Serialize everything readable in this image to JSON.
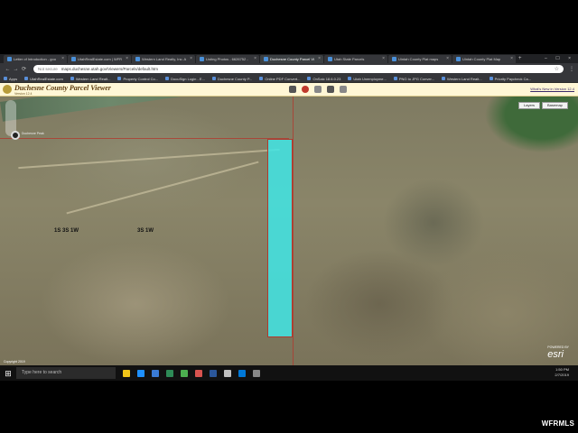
{
  "browser": {
    "tabs": [
      {
        "label": "Letter of Introduction - goo"
      },
      {
        "label": "UtahRealEstate.com | WFR"
      },
      {
        "label": "Western Land Realty, Inc. A"
      },
      {
        "label": "Listing Photos - 6626752 -"
      },
      {
        "label": "Duchesne County Parcel Vi"
      },
      {
        "label": "Utah State Parcels"
      },
      {
        "label": "Uintah County Plat maps"
      },
      {
        "label": "Uintah County Plat Map"
      }
    ],
    "active_tab_index": 4,
    "close_glyph": "×",
    "new_tab_glyph": "+",
    "window_controls": "– ☐ ×",
    "nav": {
      "back": "←",
      "forward": "→",
      "reload": "⟳"
    },
    "address": {
      "secure_label": "Not secure",
      "url": "maps.duchesne.utah.gov/Viewers/Parcels/default.htm",
      "star": "☆"
    },
    "menu": "⋮",
    "bookmarks": [
      {
        "label": "Apps"
      },
      {
        "label": "UtahRealEstate.com"
      },
      {
        "label": "Western Land Realt..."
      },
      {
        "label": "Property Control Co..."
      },
      {
        "label": "DocuSign Login - E..."
      },
      {
        "label": "Duchesne County P..."
      },
      {
        "label": "Online PDF Convert..."
      },
      {
        "label": "OnSaic 18.6.0.23"
      },
      {
        "label": "Utah Unemployme..."
      },
      {
        "label": "PNG to JPG Conver..."
      },
      {
        "label": "Western Land Realt..."
      },
      {
        "label": "Priority Paycheck Ca..."
      }
    ]
  },
  "app": {
    "title": "Duchesne County Parcel Viewer",
    "version": "Version 12.4",
    "whats_new": "What's New in Version 12.4"
  },
  "map": {
    "township_labels": [
      "1S 3S 1W",
      "3S 1W"
    ],
    "pin_label": "Duchesne Peak",
    "buttons": {
      "layers": "Layers",
      "basemap": "Basemap"
    },
    "scale_text": "Copyright 2019",
    "attribution": {
      "logo": "esri",
      "powered": "POWERED BY"
    },
    "colors": {
      "parcel_fill": "#40e6e6",
      "grid_line": "#b03a2e"
    }
  },
  "taskbar": {
    "start_glyph": "⊞",
    "search_placeholder": "Type here to search",
    "time": "1:50 PM",
    "date": "2/7/2019"
  },
  "watermark": "WFRMLS"
}
